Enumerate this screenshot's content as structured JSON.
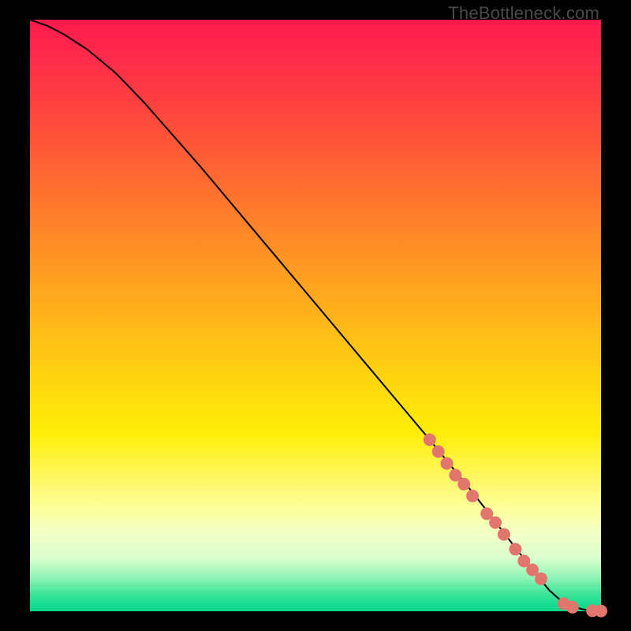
{
  "watermark": "TheBottleneck.com",
  "chart_data": {
    "type": "line",
    "title": "",
    "xlabel": "",
    "ylabel": "",
    "xlim": [
      0,
      100
    ],
    "ylim": [
      0,
      100
    ],
    "grid": false,
    "legend": false,
    "series": [
      {
        "name": "curve",
        "x": [
          0,
          3,
          6,
          10,
          15,
          20,
          30,
          40,
          50,
          60,
          70,
          78,
          84,
          88,
          91,
          93,
          95,
          97,
          98.5,
          100
        ],
        "y": [
          100,
          99,
          97.5,
          95,
          91,
          86,
          75,
          63.5,
          52,
          40.5,
          29,
          19.5,
          12,
          7,
          3.5,
          1.8,
          0.8,
          0.3,
          0.1,
          0.05
        ]
      }
    ],
    "highlight_points": {
      "name": "cluster",
      "x": [
        70,
        71.5,
        73,
        74.5,
        76,
        77.5,
        80,
        81.5,
        83,
        85,
        86.5,
        88,
        89.5,
        93.5,
        95,
        98.5,
        100
      ],
      "y": [
        29,
        27,
        25,
        23,
        21.5,
        19.5,
        16.5,
        15,
        13,
        10.5,
        8.5,
        7,
        5.5,
        1.3,
        0.7,
        0.1,
        0.05
      ]
    },
    "background_gradient": {
      "top": "#ff1a4d",
      "mid": "#ffee08",
      "bottom": "#00d88c"
    }
  }
}
